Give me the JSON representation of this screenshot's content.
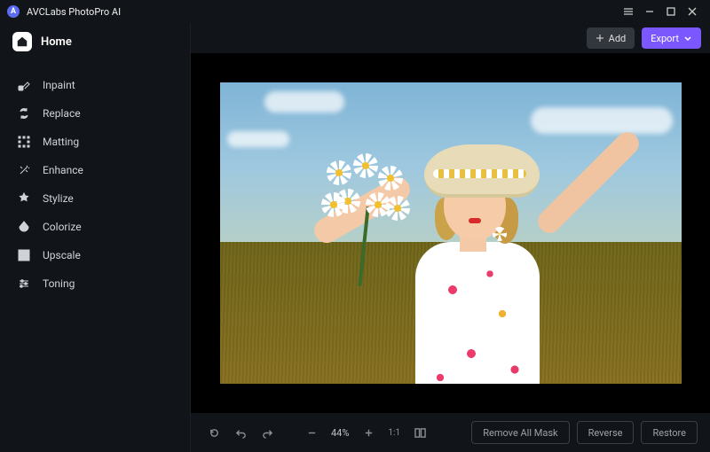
{
  "app": {
    "title": "AVCLabs PhotoPro AI"
  },
  "home": {
    "label": "Home"
  },
  "sidebar": {
    "items": [
      {
        "label": "Inpaint",
        "icon": "inpaint-icon"
      },
      {
        "label": "Replace",
        "icon": "replace-icon"
      },
      {
        "label": "Matting",
        "icon": "matting-icon"
      },
      {
        "label": "Enhance",
        "icon": "enhance-icon"
      },
      {
        "label": "Stylize",
        "icon": "stylize-icon"
      },
      {
        "label": "Colorize",
        "icon": "colorize-icon"
      },
      {
        "label": "Upscale",
        "icon": "upscale-icon"
      },
      {
        "label": "Toning",
        "icon": "toning-icon"
      }
    ]
  },
  "topbar": {
    "add_label": "Add",
    "export_label": "Export"
  },
  "zoom": {
    "percent": "44%",
    "ratio_label": "1:1"
  },
  "bottombar": {
    "remove_mask_label": "Remove All Mask",
    "reverse_label": "Reverse",
    "restore_label": "Restore"
  },
  "colors": {
    "accent": "#7b57ff"
  }
}
